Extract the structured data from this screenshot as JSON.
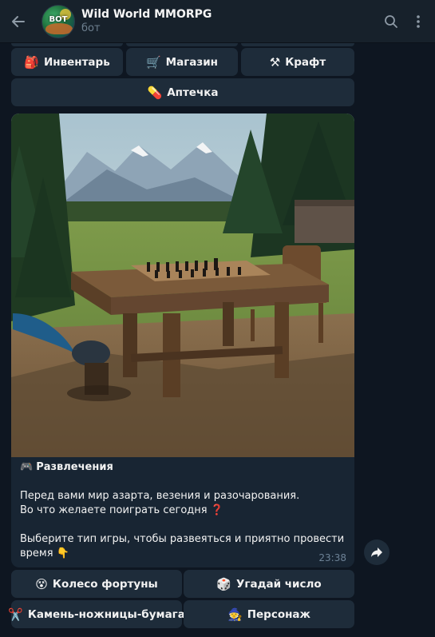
{
  "header": {
    "title": "Wild World MMORPG",
    "subtitle": "бот",
    "avatar_text": "BOT"
  },
  "keyboard_top": [
    {
      "emoji": "🎒",
      "label": "Инвентарь"
    },
    {
      "emoji": "🛒",
      "label": "Магазин"
    },
    {
      "emoji": "⚒",
      "label": "Крафт"
    }
  ],
  "keyboard_aid": {
    "emoji": "💊",
    "label": "Аптечка"
  },
  "message": {
    "title_emoji": "🎮",
    "title": "Развлечения",
    "line1": "Перед вами мир азарта, везения и разочарования.",
    "line2": "Во что желаете поиграть сегодня",
    "line2_emoji": "❓",
    "line3": "Выберите тип игры, чтобы развеяться и приятно провести",
    "line4": "время",
    "line4_emoji": "👇",
    "time": "23:38"
  },
  "inline_buttons": [
    {
      "emoji": "😵",
      "label": "Колесо фортуны"
    },
    {
      "emoji": "🎲",
      "label": "Угадай число"
    },
    {
      "emoji": "✂️",
      "label": "Камень-ножницы-бумага"
    },
    {
      "emoji": "🧙",
      "label": "Персонаж"
    }
  ],
  "colors": {
    "background": "#0e1621",
    "header": "#17212b",
    "button": "#1e2c3a",
    "bubble": "#182533",
    "time": "#6d8296"
  }
}
